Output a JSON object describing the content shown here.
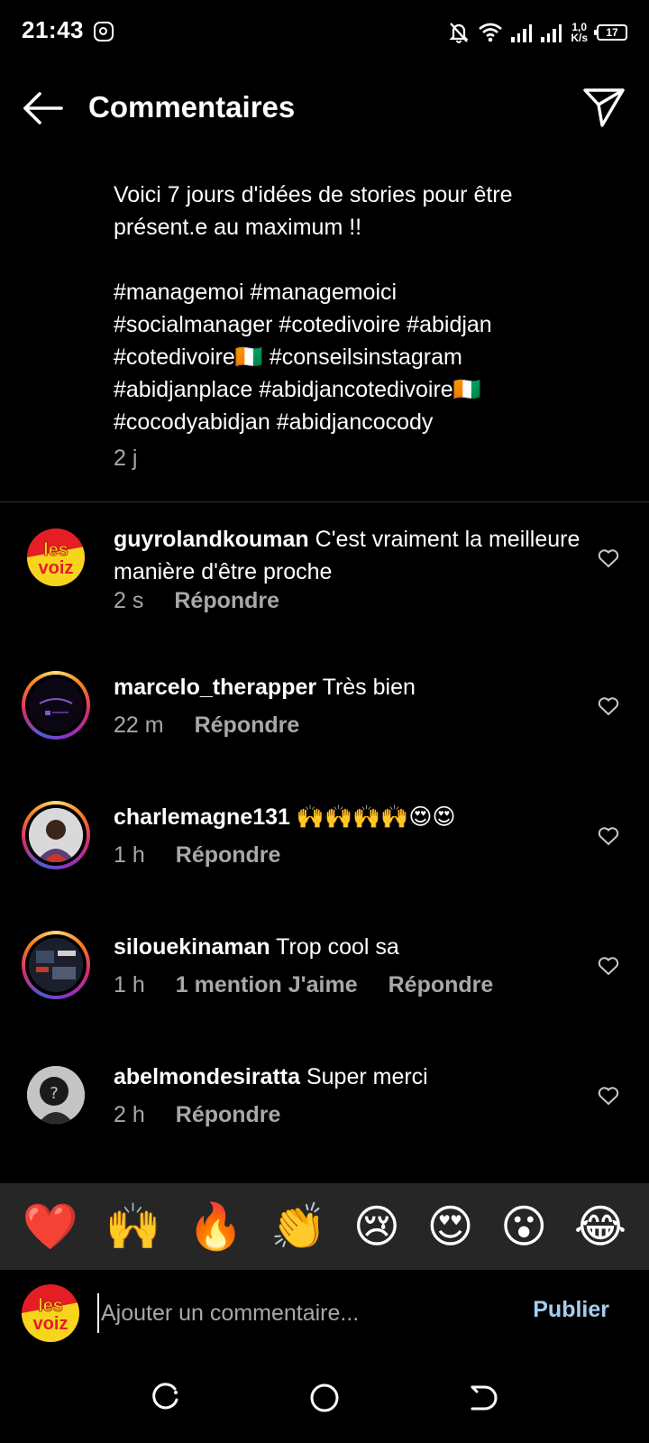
{
  "status_bar": {
    "time": "21:43",
    "speed_value": "1,0",
    "speed_unit": "K/s",
    "battery": "17"
  },
  "header": {
    "title": "Commentaires"
  },
  "caption": {
    "line1": "Voici 7 jours d'idées de stories pour être",
    "line2": "présent.e au maximum !!",
    "tags1": "#managemoi #managemoici",
    "tags2": "#socialmanager #cotedivoire #abidjan",
    "tags3": "#cotedivoire🇨🇮 #conseilsinstagram",
    "tags4": "#abidjanplace #abidjancotedivoire🇨🇮",
    "tags5": "#cocodyabidjan #abidjancocody",
    "age": "2 j"
  },
  "comments": [
    {
      "username": "guyrolandkouman",
      "text": " C'est vraiment la meilleure manière d'être proche",
      "age": "2 s",
      "reply_label": "Répondre"
    },
    {
      "username": "marcelo_therapper",
      "text": " Très bien",
      "age": "22 m",
      "reply_label": "Répondre"
    },
    {
      "username": "charlemagne131",
      "text": " 🙌🙌🙌🙌😍😍",
      "age": "1 h",
      "reply_label": "Répondre"
    },
    {
      "username": "silouekinaman",
      "text": " Trop cool sa",
      "age": "1 h",
      "likes": "1 mention J'aime",
      "reply_label": "Répondre"
    },
    {
      "username": "abelmondesiratta",
      "text": " Super merci",
      "age": "2 h",
      "reply_label": "Répondre"
    }
  ],
  "emoji_bar": [
    "❤️",
    "🙌",
    "🔥",
    "👏",
    "😢",
    "😍",
    "😮",
    "😂"
  ],
  "composer": {
    "placeholder": "Ajouter un commentaire...",
    "publish_label": "Publier"
  },
  "colors": {
    "background": "#000000",
    "secondary_text": "#a8a8a8",
    "publish": "#a5cdf2",
    "emoji_bar_bg": "#262626"
  },
  "logo_text": "les voiz"
}
